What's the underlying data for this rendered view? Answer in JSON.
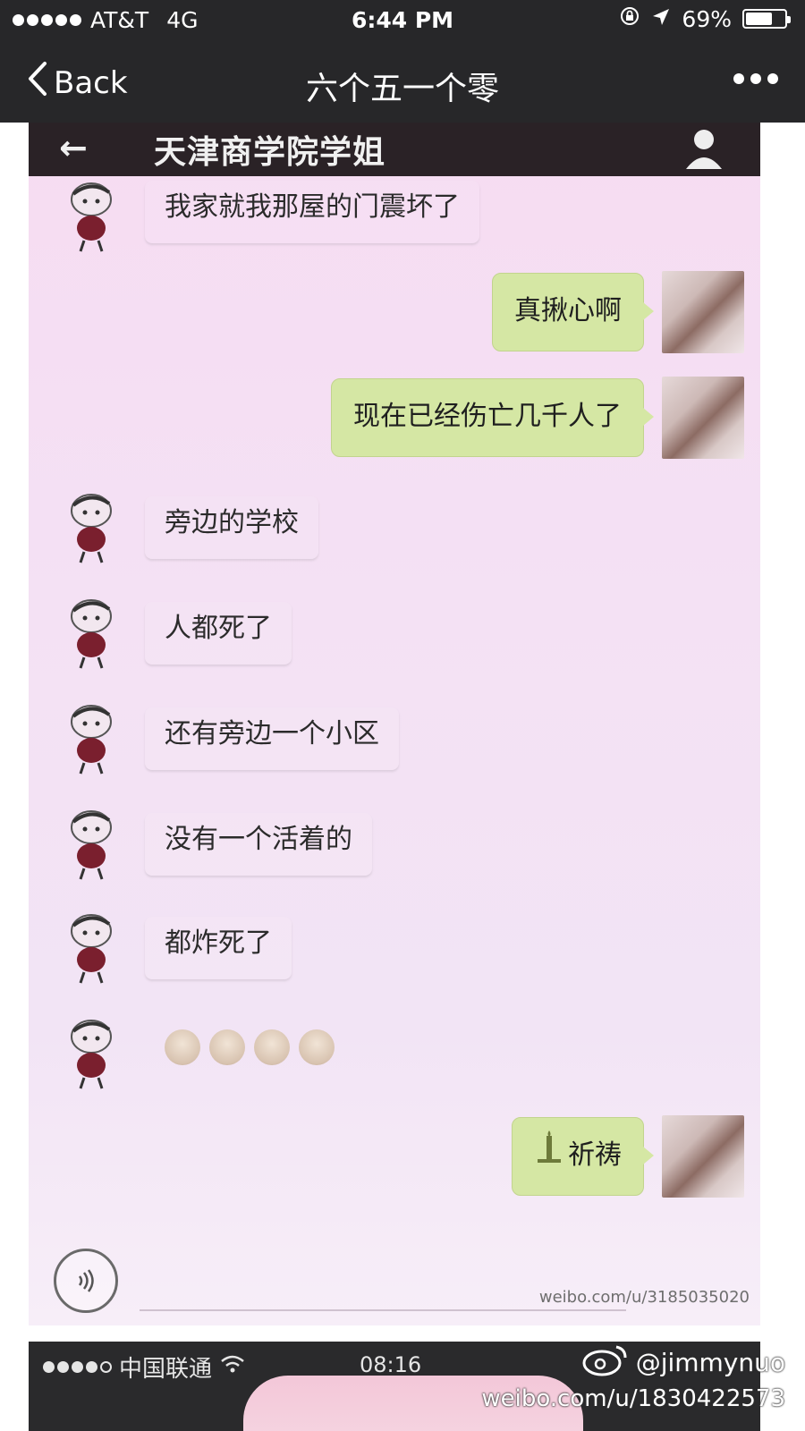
{
  "status_bar": {
    "carrier": "AT&T",
    "network": "4G",
    "time": "6:44 PM",
    "battery": "69%",
    "battery_level": 0.69
  },
  "nav": {
    "back_label": "Back",
    "title": "六个五一个零"
  },
  "chat": {
    "title": "天津商学院学姐",
    "messages": [
      {
        "side": "left",
        "text": "我家就我那屋的门震坏了"
      },
      {
        "side": "right",
        "text": "真揪心啊"
      },
      {
        "side": "right",
        "text": "现在已经伤亡几千人了"
      },
      {
        "side": "left",
        "text": "旁边的学校"
      },
      {
        "side": "left",
        "text": "人都死了"
      },
      {
        "side": "left",
        "text": "还有旁边一个小区"
      },
      {
        "side": "left",
        "text": "没有一个活着的"
      },
      {
        "side": "left",
        "text": "都炸死了"
      },
      {
        "side": "left",
        "text": "",
        "emoji_count": 4
      },
      {
        "side": "right",
        "text": "祈祷"
      }
    ],
    "inner_watermark": "weibo.com/u/3185035020"
  },
  "bottom_strip": {
    "carrier": "中国联通",
    "time": "08:16"
  },
  "watermark": {
    "handle": "@jimmynuo",
    "url": "weibo.com/u/1830422573"
  },
  "colors": {
    "chrome": "#272729",
    "chat_bg": "#f4e1f4",
    "bubble_right": "#d5e7a4"
  }
}
